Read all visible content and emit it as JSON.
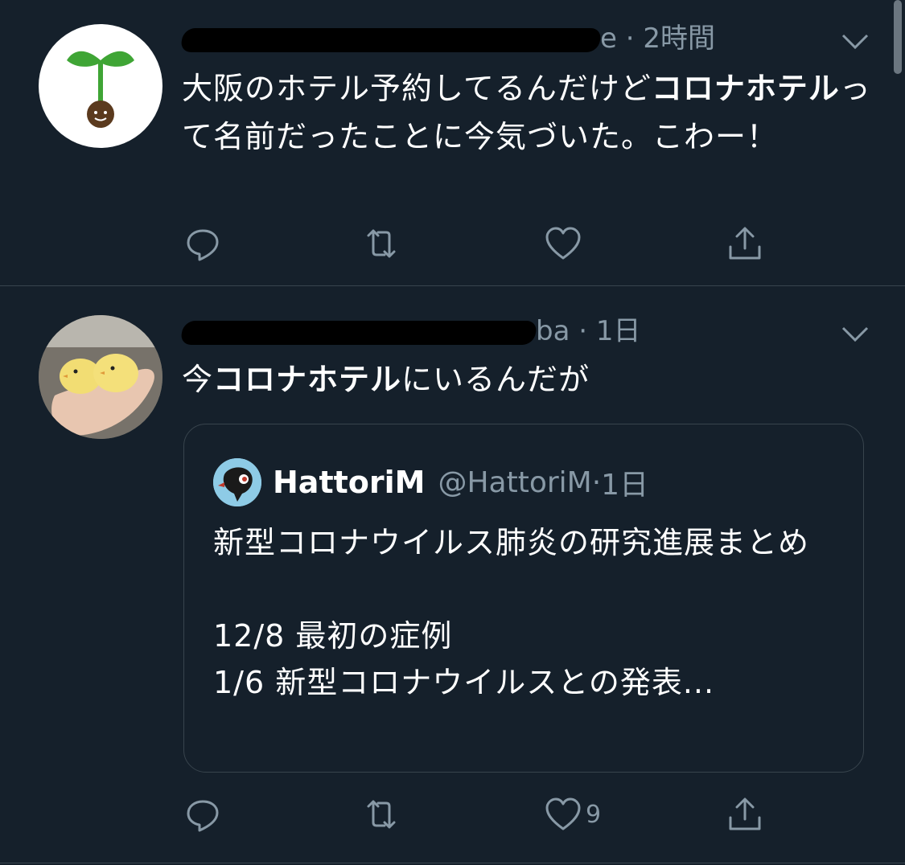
{
  "tweets": [
    {
      "time": "2時間",
      "handle_visible_tail": "e",
      "text_parts": [
        {
          "t": "大阪のホテル予約してるんだけど",
          "bold": false
        },
        {
          "t": "コロナホテル",
          "bold": true
        },
        {
          "t": "って名前だったことに今気づいた。こわー！",
          "bold": false
        }
      ],
      "actions": {
        "reply": "",
        "retweet": "",
        "like": "",
        "share": ""
      },
      "avatar_icon": "sprout-icon"
    },
    {
      "time": "1日",
      "handle_visible_tail": "ba",
      "text_parts": [
        {
          "t": "今",
          "bold": false
        },
        {
          "t": "コロナホテル",
          "bold": true
        },
        {
          "t": "にいるんだが",
          "bold": false
        }
      ],
      "quote": {
        "name": "HattoriM",
        "handle": "@HattoriM",
        "time": "1日",
        "text": "新型コロナウイルス肺炎の研究進展まとめ\n\n12/8 最初の症例\n1/6 新型コロナウイルスとの発表..."
      },
      "actions": {
        "reply": "",
        "retweet": "",
        "like": "9",
        "share": ""
      },
      "avatar_icon": "chicks-photo"
    }
  ],
  "separator": " · ",
  "colors": {
    "background": "#15202b",
    "muted": "#8899a6",
    "border": "#38444d"
  }
}
